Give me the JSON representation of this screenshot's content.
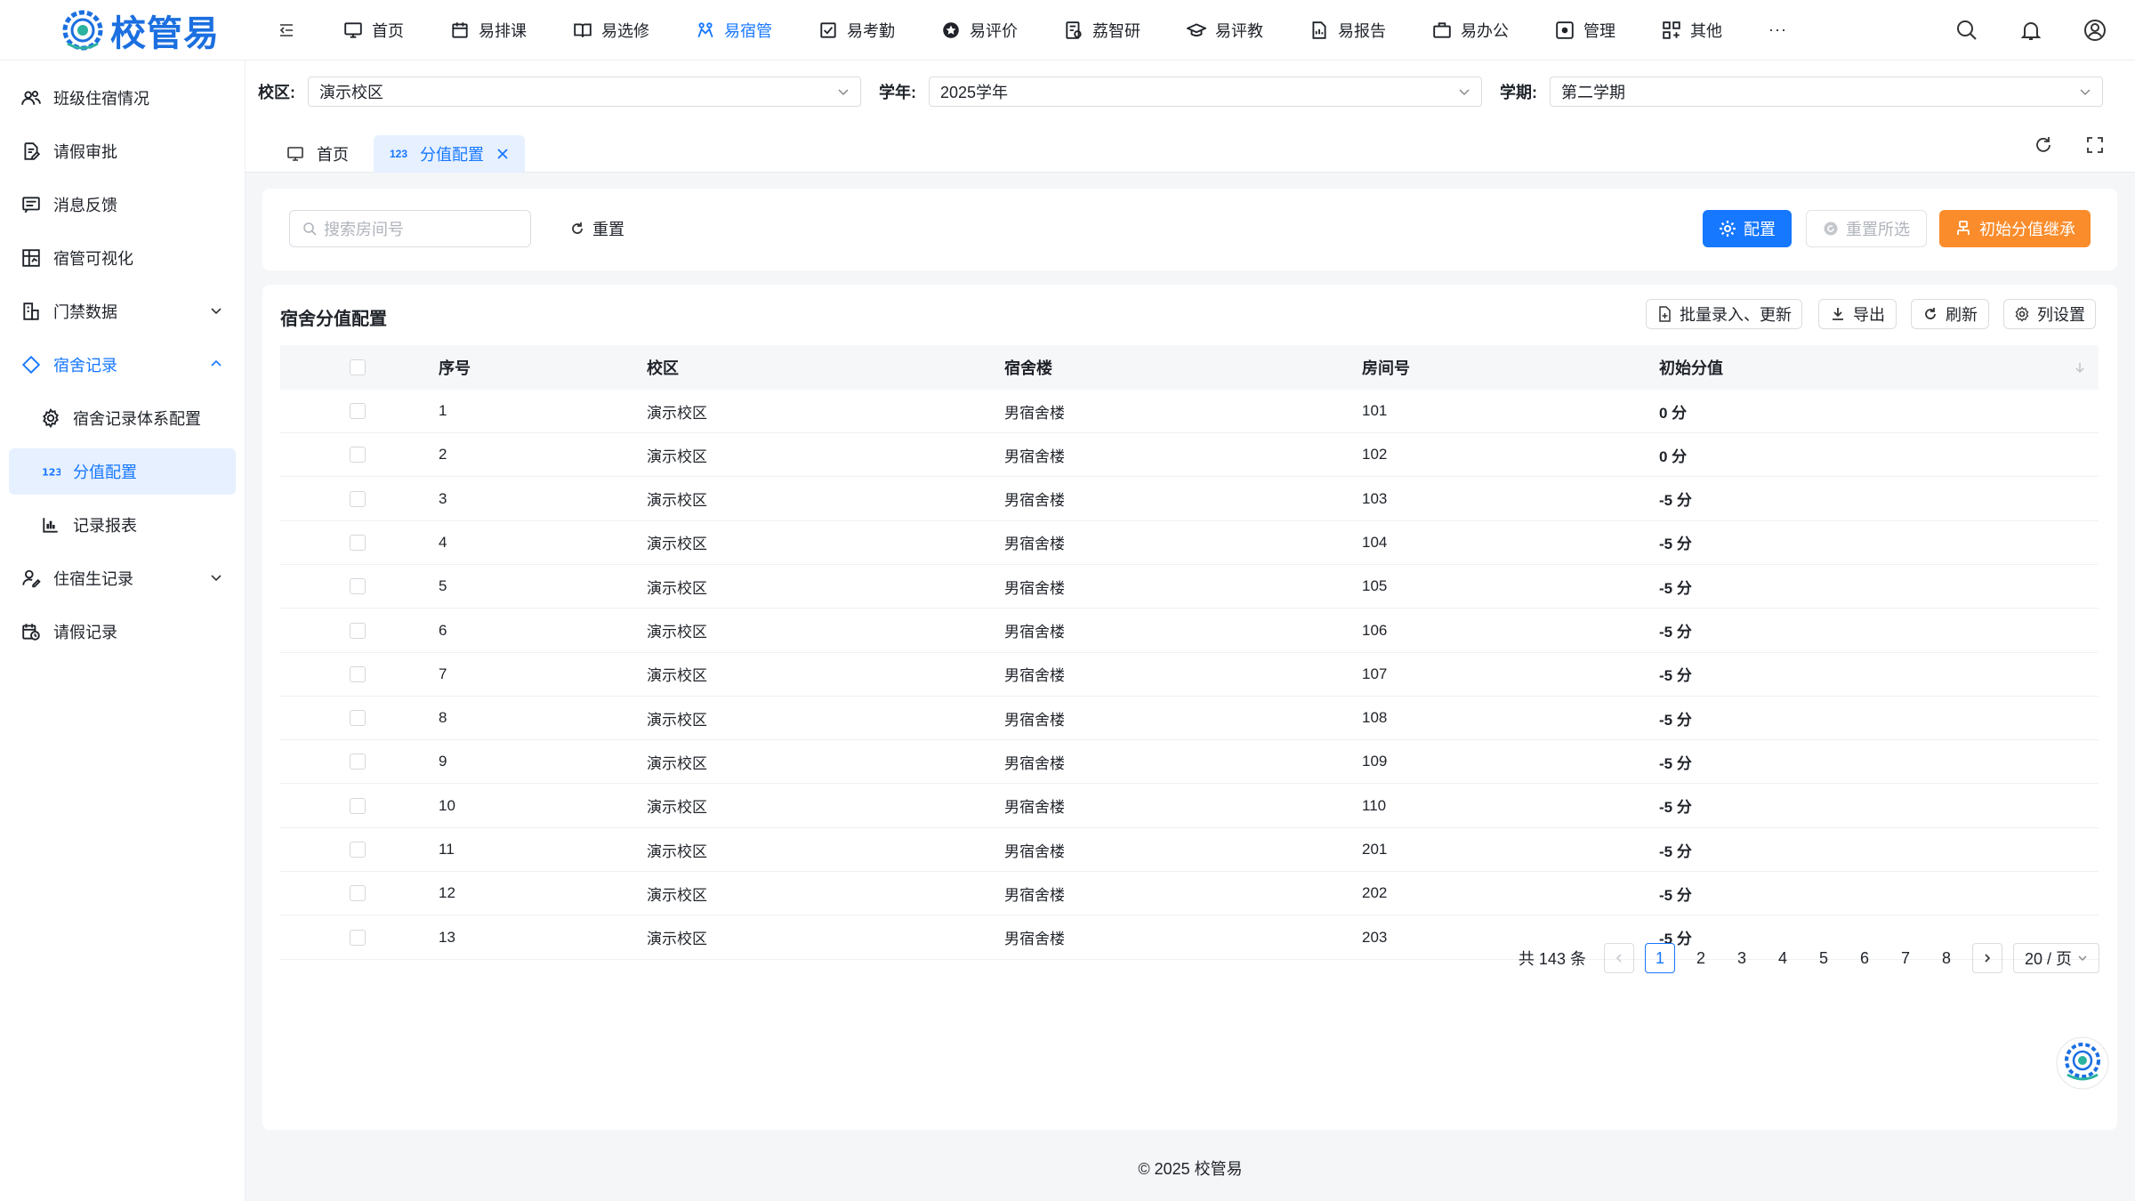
{
  "brand": {
    "logo_text": "校管易",
    "primary": "#1677ff",
    "accent": "#fa8c2b"
  },
  "topnav": {
    "items": [
      {
        "label": "首页",
        "icon": "monitor-icon"
      },
      {
        "label": "易排课",
        "icon": "calendar-icon"
      },
      {
        "label": "易选修",
        "icon": "book-icon"
      },
      {
        "label": "易宿管",
        "icon": "dorm-icon",
        "active": true
      },
      {
        "label": "易考勤",
        "icon": "checklist-icon"
      },
      {
        "label": "易评价",
        "icon": "star-icon"
      },
      {
        "label": "荔智研",
        "icon": "research-icon"
      },
      {
        "label": "易评教",
        "icon": "graduation-icon"
      },
      {
        "label": "易报告",
        "icon": "report-icon"
      },
      {
        "label": "易办公",
        "icon": "briefcase-icon"
      },
      {
        "label": "管理",
        "icon": "settings-box-icon"
      },
      {
        "label": "其他",
        "icon": "grid-icon"
      }
    ],
    "more": "···"
  },
  "sidebar": {
    "items": [
      {
        "label": "班级住宿情况",
        "icon": "people-icon"
      },
      {
        "label": "请假审批",
        "icon": "doc-edit-icon"
      },
      {
        "label": "消息反馈",
        "icon": "message-icon"
      },
      {
        "label": "宿管可视化",
        "icon": "chart-box-icon"
      },
      {
        "label": "门禁数据",
        "icon": "gate-icon",
        "expandable": true
      },
      {
        "label": "宿舍记录",
        "icon": "diamond-icon",
        "expanded": true
      },
      {
        "label": "宿舍记录体系配置",
        "icon": "gear-icon",
        "sub": true
      },
      {
        "label": "分值配置",
        "icon": "number-123-icon",
        "sub": true,
        "selected": true
      },
      {
        "label": "记录报表",
        "icon": "bar-chart-icon",
        "sub": true
      },
      {
        "label": "住宿生记录",
        "icon": "person-edit-icon",
        "expandable": true
      },
      {
        "label": "请假记录",
        "icon": "calendar-clock-icon"
      }
    ]
  },
  "filters": {
    "campus_label": "校区:",
    "campus_value": "演示校区",
    "year_label": "学年:",
    "year_value": "2025学年",
    "term_label": "学期:",
    "term_value": "第二学期"
  },
  "tabs": {
    "home": "首页",
    "current": "分值配置",
    "current_icon_text": "123"
  },
  "toolbar": {
    "search_placeholder": "搜索房间号",
    "reset": "重置",
    "config": "配置",
    "reset_selected": "重置所选",
    "inherit": "初始分值继承"
  },
  "table": {
    "title": "宿舍分值配置",
    "actions": {
      "batch": "批量录入、更新",
      "export": "导出",
      "refresh": "刷新",
      "columns": "列设置"
    },
    "columns": [
      "序号",
      "校区",
      "宿舍楼",
      "房间号",
      "初始分值"
    ],
    "rows": [
      [
        "1",
        "演示校区",
        "男宿舍楼",
        "101",
        "0 分"
      ],
      [
        "2",
        "演示校区",
        "男宿舍楼",
        "102",
        "0 分"
      ],
      [
        "3",
        "演示校区",
        "男宿舍楼",
        "103",
        "-5 分"
      ],
      [
        "4",
        "演示校区",
        "男宿舍楼",
        "104",
        "-5 分"
      ],
      [
        "5",
        "演示校区",
        "男宿舍楼",
        "105",
        "-5 分"
      ],
      [
        "6",
        "演示校区",
        "男宿舍楼",
        "106",
        "-5 分"
      ],
      [
        "7",
        "演示校区",
        "男宿舍楼",
        "107",
        "-5 分"
      ],
      [
        "8",
        "演示校区",
        "男宿舍楼",
        "108",
        "-5 分"
      ],
      [
        "9",
        "演示校区",
        "男宿舍楼",
        "109",
        "-5 分"
      ],
      [
        "10",
        "演示校区",
        "男宿舍楼",
        "110",
        "-5 分"
      ],
      [
        "11",
        "演示校区",
        "男宿舍楼",
        "201",
        "-5 分"
      ],
      [
        "12",
        "演示校区",
        "男宿舍楼",
        "202",
        "-5 分"
      ],
      [
        "13",
        "演示校区",
        "男宿舍楼",
        "203",
        "-5 分"
      ]
    ]
  },
  "pagination": {
    "total": "共 143 条",
    "pages": [
      "1",
      "2",
      "3",
      "4",
      "5",
      "6",
      "7",
      "8"
    ],
    "current": "1",
    "page_size": "20 / 页"
  },
  "footer": "© 2025 校管易"
}
